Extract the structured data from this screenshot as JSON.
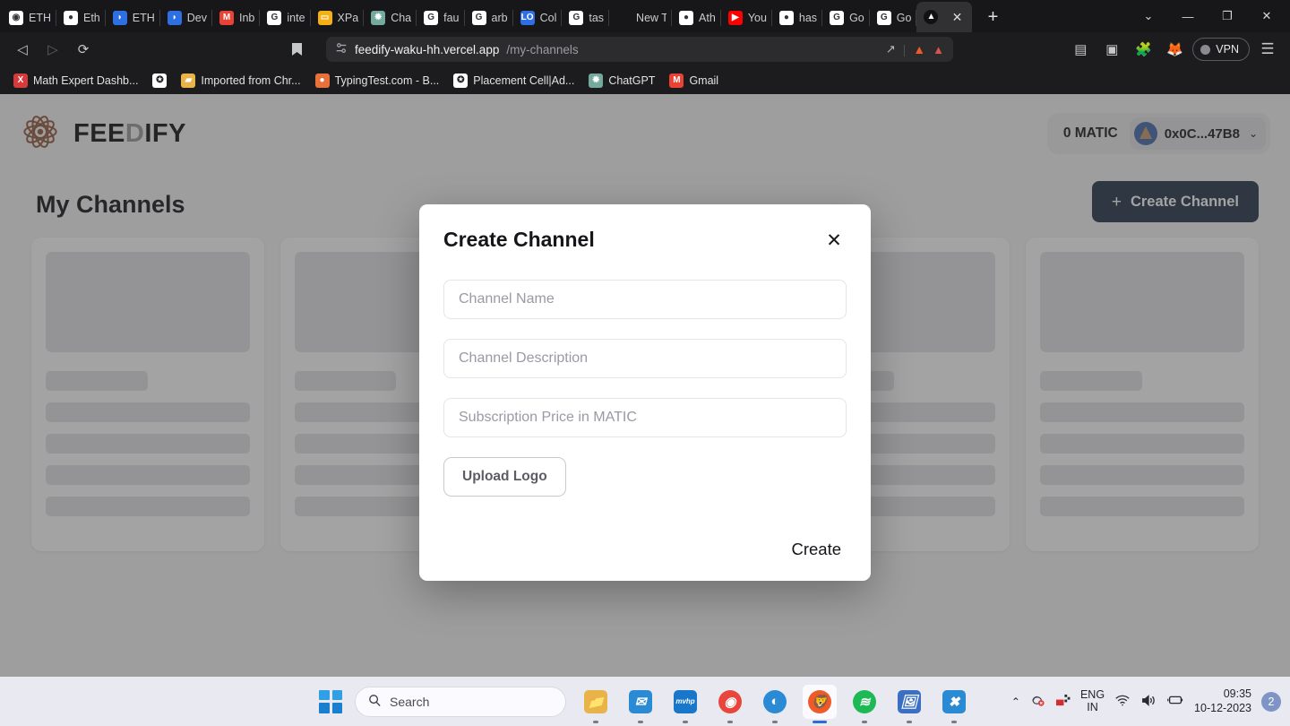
{
  "browser": {
    "tabs": [
      {
        "label": "ETH",
        "icon": "opensea-icon",
        "color": "#ffffff",
        "glyph": "◉"
      },
      {
        "label": "Eth",
        "icon": "github-icon",
        "color": "#ffffff",
        "glyph": "●"
      },
      {
        "label": "ETH",
        "icon": "ethereum-icon",
        "color": "#2f6fe4",
        "glyph": "◗"
      },
      {
        "label": "Dev",
        "icon": "ethereum-icon",
        "color": "#2f6fe4",
        "glyph": "◗"
      },
      {
        "label": "Inb",
        "icon": "gmail-icon",
        "color": "#ea4335",
        "glyph": "M"
      },
      {
        "label": "inte",
        "icon": "google-icon",
        "color": "#ffffff",
        "glyph": "G"
      },
      {
        "label": "XPa",
        "icon": "xpanel-icon",
        "color": "#f5b014",
        "glyph": "▭"
      },
      {
        "label": "Cha",
        "icon": "chatgpt-icon",
        "color": "#74aa9c",
        "glyph": "✹"
      },
      {
        "label": "fau",
        "icon": "google-icon",
        "color": "#ffffff",
        "glyph": "G"
      },
      {
        "label": "arb",
        "icon": "google-icon",
        "color": "#ffffff",
        "glyph": "G"
      },
      {
        "label": "Col",
        "icon": "logo-icon",
        "color": "#2f6fe4",
        "glyph": "LO"
      },
      {
        "label": "tas",
        "icon": "google-icon",
        "color": "#ffffff",
        "glyph": "G"
      },
      {
        "label": "New Tab",
        "icon": "blank-icon",
        "color": "#1c1c1e",
        "glyph": ""
      },
      {
        "label": "Ath",
        "icon": "github-icon",
        "color": "#ffffff",
        "glyph": "●"
      },
      {
        "label": "You",
        "icon": "youtube-icon",
        "color": "#ff0000",
        "glyph": "▶"
      },
      {
        "label": "has",
        "icon": "github-icon",
        "color": "#ffffff",
        "glyph": "●"
      },
      {
        "label": "Go",
        "icon": "google-icon",
        "color": "#ffffff",
        "glyph": "G"
      },
      {
        "label": "Go",
        "icon": "google-icon",
        "color": "#ffffff",
        "glyph": "G"
      }
    ],
    "active_tab": {
      "label": "",
      "icon": "brave-icon",
      "close_glyph": "✕"
    },
    "new_tab_glyph": "+",
    "window_controls": [
      {
        "name": "tab-search-button",
        "glyph": "⌄"
      },
      {
        "name": "minimize-button",
        "glyph": "—"
      },
      {
        "name": "maximize-button",
        "glyph": "❐"
      },
      {
        "name": "close-window-button",
        "glyph": "✕"
      }
    ],
    "nav": {
      "back_glyph": "◁",
      "forward_glyph": "▷",
      "reload_glyph": "⟳",
      "bookmark_glyph": "🔖"
    },
    "url": {
      "site_settings_glyph": "⚯",
      "host": "feedify-waku-hh.vercel.app",
      "path": "/my-channels",
      "share_glyph": "↗",
      "brave_shield_glyph": "🦁",
      "alert_glyph": "▲"
    },
    "toolbar_right": [
      {
        "name": "metamask-extension-icon",
        "glyph": "🦊"
      },
      {
        "name": "extensions-icon",
        "glyph": "🧩"
      },
      {
        "name": "sidebar-toggle-icon",
        "glyph": "▣"
      },
      {
        "name": "wallet-icon",
        "glyph": "▤"
      }
    ],
    "vpn_label": "VPN",
    "menu_glyph": "☰",
    "bookmarks": [
      {
        "label": "Math Expert Dashb...",
        "icon": "excel-icon",
        "color": "#d63a3a",
        "glyph": "X"
      },
      {
        "label": "",
        "icon": "globe-icon",
        "color": "#ffffff",
        "glyph": "✪"
      },
      {
        "label": "Imported from Chr...",
        "icon": "folder-icon",
        "color": "#e8b44a",
        "glyph": "▰"
      },
      {
        "label": "TypingTest.com - B...",
        "icon": "typingtest-icon",
        "color": "#e8703a",
        "glyph": "●"
      },
      {
        "label": "Placement Cell|Ad...",
        "icon": "globe-icon",
        "color": "#ffffff",
        "glyph": "✪"
      },
      {
        "label": "ChatGPT",
        "icon": "chatgpt-icon",
        "color": "#74aa9c",
        "glyph": "✹"
      },
      {
        "label": "Gmail",
        "icon": "gmail-icon",
        "color": "#ea4335",
        "glyph": "M"
      }
    ]
  },
  "app": {
    "brand": {
      "name_prefix": "FEE",
      "name_d": "D",
      "name_suffix": "IFY",
      "logo_icon": "feedify-atom-logo"
    },
    "wallet": {
      "balance": "0 MATIC",
      "address": "0x0C...47B8",
      "caret_glyph": "⌄",
      "avatar_icon": "wallet-avatar-icon"
    },
    "page_title": "My Channels",
    "create_channel_button": {
      "label": "Create Channel",
      "plus_glyph": "+",
      "color": "#1c3557"
    },
    "skeleton_cards": 5,
    "skeleton_lines_per_card": 4
  },
  "modal": {
    "title": "Create Channel",
    "close_glyph": "✕",
    "fields": [
      {
        "name": "channel-name-input",
        "placeholder": "Channel Name",
        "value": ""
      },
      {
        "name": "channel-description-input",
        "placeholder": "Channel Description",
        "value": ""
      },
      {
        "name": "subscription-price-input",
        "placeholder": "Subscription Price in MATIC",
        "value": ""
      }
    ],
    "upload_label": "Upload Logo",
    "submit_label": "Create"
  },
  "taskbar": {
    "start_name": "windows-start-button",
    "search": {
      "placeholder": "Search",
      "icon": "search-icon"
    },
    "apps": [
      {
        "name": "file-explorer-icon",
        "glyph": "📁",
        "active": false
      },
      {
        "name": "mail-icon",
        "glyph": "✉",
        "active": false
      },
      {
        "name": "mvhp-app-icon",
        "glyph": "mvhp",
        "active": false
      },
      {
        "name": "chrome-icon",
        "glyph": "◉",
        "active": false
      },
      {
        "name": "edge-icon",
        "glyph": "◐",
        "active": false
      },
      {
        "name": "brave-icon",
        "glyph": "🦁",
        "active": true
      },
      {
        "name": "spotify-icon",
        "glyph": "≋",
        "active": false
      },
      {
        "name": "photos-icon",
        "glyph": "🖼",
        "active": false
      },
      {
        "name": "vscode-icon",
        "glyph": "✖",
        "active": false
      }
    ],
    "tray": {
      "chevron_glyph": "⌃",
      "bluetooth_icon": "bluetooth-off-icon",
      "app_icon": "tray-app-icon",
      "language_line1": "ENG",
      "language_line2": "IN",
      "wifi_glyph": "📶",
      "volume_glyph": "🔊",
      "battery_glyph": "🔋",
      "time": "09:35",
      "date": "10-12-2023",
      "notification_count": "2"
    }
  }
}
